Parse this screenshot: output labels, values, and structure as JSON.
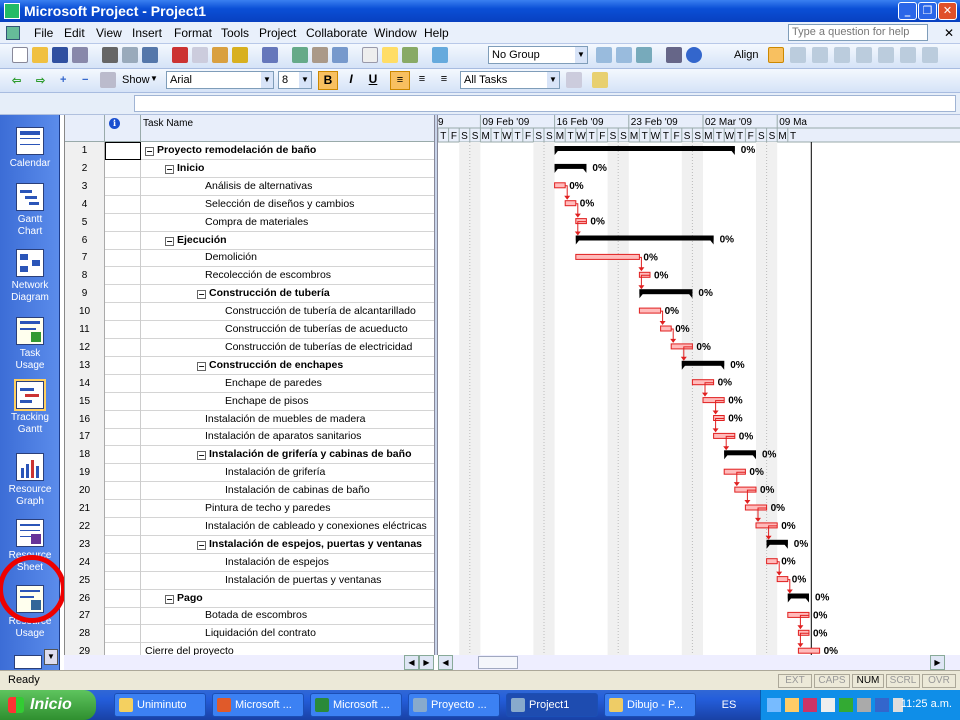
{
  "window": {
    "title": "Microsoft Project - Project1"
  },
  "menubar": {
    "items": [
      "File",
      "Edit",
      "View",
      "Insert",
      "Format",
      "Tools",
      "Project",
      "Collaborate",
      "Window",
      "Help"
    ],
    "help_placeholder": "Type a question for help"
  },
  "toolbar1": {
    "group_value": "No Group",
    "align_label": "Align"
  },
  "toolbar2": {
    "show_label": "Show",
    "font_value": "Arial",
    "size_value": "8",
    "bold": "B",
    "italic": "I",
    "underline": "U",
    "filter_value": "All Tasks"
  },
  "viewbar": {
    "items": [
      {
        "label": "Calendar",
        "icon": "calendar-icon"
      },
      {
        "label": "Gantt Chart",
        "icon": "gantt-icon"
      },
      {
        "label": "Network Diagram",
        "icon": "network-icon"
      },
      {
        "label": "Task Usage",
        "icon": "task-usage-icon"
      },
      {
        "label": "Tracking Gantt",
        "icon": "tracking-icon"
      },
      {
        "label": "Resource Graph",
        "icon": "resource-graph-icon"
      },
      {
        "label": "Resource Sheet",
        "icon": "resource-sheet-icon"
      },
      {
        "label": "Resource Usage",
        "icon": "resource-usage-icon"
      }
    ],
    "highlight_color": "#e00000"
  },
  "grid": {
    "column_indicator_icon": "info-icon",
    "column_task_name": "Task Name",
    "tasks": [
      {
        "id": "1",
        "name": "Proyecto remodelación de baño",
        "level": 0,
        "summary": true
      },
      {
        "id": "2",
        "name": "Inicio",
        "level": 1,
        "summary": true
      },
      {
        "id": "3",
        "name": "Análisis de alternativas",
        "level": 2,
        "summary": false
      },
      {
        "id": "4",
        "name": "Selección de diseños y cambios",
        "level": 2,
        "summary": false
      },
      {
        "id": "5",
        "name": "Compra de materiales",
        "level": 2,
        "summary": false
      },
      {
        "id": "6",
        "name": "Ejecución",
        "level": 1,
        "summary": true
      },
      {
        "id": "7",
        "name": "Demolición",
        "level": 2,
        "summary": false
      },
      {
        "id": "8",
        "name": "Recolección de escombros",
        "level": 2,
        "summary": false
      },
      {
        "id": "9",
        "name": "Construcción de tubería",
        "level": 2,
        "summary": true
      },
      {
        "id": "10",
        "name": "Construcción de tubería de alcantarillado",
        "level": 3,
        "summary": false
      },
      {
        "id": "11",
        "name": "Construcción de tuberías de acueducto",
        "level": 3,
        "summary": false
      },
      {
        "id": "12",
        "name": "Construcción de tuberías de electricidad",
        "level": 3,
        "summary": false
      },
      {
        "id": "13",
        "name": "Construcción de enchapes",
        "level": 2,
        "summary": true
      },
      {
        "id": "14",
        "name": "Enchape de paredes",
        "level": 3,
        "summary": false
      },
      {
        "id": "15",
        "name": "Enchape de pisos",
        "level": 3,
        "summary": false
      },
      {
        "id": "16",
        "name": "Instalación de muebles de madera",
        "level": 2,
        "summary": false
      },
      {
        "id": "17",
        "name": "Instalación de aparatos sanitarios",
        "level": 2,
        "summary": false
      },
      {
        "id": "18",
        "name": "Instalación de grifería y cabinas de baño",
        "level": 2,
        "summary": true
      },
      {
        "id": "19",
        "name": "Instalación de grifería",
        "level": 3,
        "summary": false
      },
      {
        "id": "20",
        "name": "Instalación de cabinas de baño",
        "level": 3,
        "summary": false
      },
      {
        "id": "21",
        "name": "Pintura de techo y paredes",
        "level": 2,
        "summary": false
      },
      {
        "id": "22",
        "name": "Instalación de cableado y conexiones eléctricas",
        "level": 2,
        "summary": false
      },
      {
        "id": "23",
        "name": "Instalación de espejos, puertas y ventanas",
        "level": 2,
        "summary": true
      },
      {
        "id": "24",
        "name": "Instalación de espejos",
        "level": 3,
        "summary": false
      },
      {
        "id": "25",
        "name": "Instalación de puertas y ventanas",
        "level": 3,
        "summary": false
      },
      {
        "id": "26",
        "name": "Pago",
        "level": 1,
        "summary": true
      },
      {
        "id": "27",
        "name": "Botada de escombros",
        "level": 2,
        "summary": false
      },
      {
        "id": "28",
        "name": "Liquidación del contrato",
        "level": 2,
        "summary": false
      },
      {
        "id": "29",
        "name": "Cierre del proyecto",
        "level": 0,
        "summary": false
      }
    ]
  },
  "gantt": {
    "weeks": [
      "9",
      "09 Feb '09",
      "16 Feb '09",
      "23 Feb '09",
      "02 Mar '09",
      "09 Ma"
    ],
    "days": [
      "T",
      "F",
      "S",
      "S",
      "M",
      "T",
      "W",
      "T",
      "F",
      "S",
      "S",
      "M",
      "T",
      "W",
      "T",
      "F",
      "S",
      "S",
      "M",
      "T",
      "W",
      "T",
      "F",
      "S",
      "S",
      "M",
      "T",
      "W",
      "T",
      "F",
      "S",
      "S",
      "M",
      "T"
    ],
    "first_day": "2009-02-05",
    "bars": [
      {
        "row": 1,
        "start": "2009-02-16",
        "end": "2009-03-04",
        "type": "summary",
        "pct": "0%"
      },
      {
        "row": 2,
        "start": "2009-02-16",
        "end": "2009-02-18",
        "type": "summary",
        "pct": "0%"
      },
      {
        "row": 3,
        "start": "2009-02-16",
        "end": "2009-02-16",
        "type": "task",
        "pct": "0%"
      },
      {
        "row": 4,
        "start": "2009-02-17",
        "end": "2009-02-17",
        "type": "task",
        "pct": "0%"
      },
      {
        "row": 5,
        "start": "2009-02-18",
        "end": "2009-02-18",
        "type": "task",
        "pct": "0%"
      },
      {
        "row": 6,
        "start": "2009-02-18",
        "end": "2009-03-02",
        "type": "summary",
        "pct": "0%"
      },
      {
        "row": 7,
        "start": "2009-02-18",
        "end": "2009-02-23",
        "type": "task",
        "pct": "0%"
      },
      {
        "row": 8,
        "start": "2009-02-24",
        "end": "2009-02-24",
        "type": "task",
        "pct": "0%"
      },
      {
        "row": 9,
        "start": "2009-02-24",
        "end": "2009-02-28",
        "type": "summary",
        "pct": "0%"
      },
      {
        "row": 10,
        "start": "2009-02-24",
        "end": "2009-02-25",
        "type": "task",
        "pct": "0%"
      },
      {
        "row": 11,
        "start": "2009-02-26",
        "end": "2009-02-26",
        "type": "task",
        "pct": "0%"
      },
      {
        "row": 12,
        "start": "2009-02-27",
        "end": "2009-02-28",
        "type": "task",
        "pct": "0%"
      },
      {
        "row": 13,
        "start": "2009-02-28",
        "end": "2009-03-03",
        "type": "summary",
        "pct": "0%"
      },
      {
        "row": 14,
        "start": "2009-03-01",
        "end": "2009-03-02",
        "type": "task",
        "pct": "0%"
      },
      {
        "row": 15,
        "start": "2009-03-02",
        "end": "2009-03-03",
        "type": "task",
        "pct": "0%"
      },
      {
        "row": 16,
        "start": "2009-03-03",
        "end": "2009-03-03",
        "type": "task",
        "pct": "0%"
      },
      {
        "row": 17,
        "start": "2009-03-03",
        "end": "2009-03-04",
        "type": "task",
        "pct": "0%"
      },
      {
        "row": 18,
        "start": "2009-03-04",
        "end": "2009-03-06",
        "type": "summary",
        "pct": "0%"
      },
      {
        "row": 19,
        "start": "2009-03-04",
        "end": "2009-03-05",
        "type": "task",
        "pct": "0%"
      },
      {
        "row": 20,
        "start": "2009-03-05",
        "end": "2009-03-06",
        "type": "task",
        "pct": "0%"
      },
      {
        "row": 21,
        "start": "2009-03-06",
        "end": "2009-03-07",
        "type": "task",
        "pct": "0%"
      },
      {
        "row": 22,
        "start": "2009-03-07",
        "end": "2009-03-08",
        "type": "task",
        "pct": "0%"
      },
      {
        "row": 23,
        "start": "2009-03-08",
        "end": "2009-03-09",
        "type": "summary",
        "pct": "0%"
      },
      {
        "row": 24,
        "start": "2009-03-08",
        "end": "2009-03-08",
        "type": "task",
        "pct": "0%"
      },
      {
        "row": 25,
        "start": "2009-03-09",
        "end": "2009-03-09",
        "type": "task",
        "pct": "0%"
      },
      {
        "row": 26,
        "start": "2009-03-10",
        "end": "2009-03-11",
        "type": "summary",
        "pct": "0%"
      },
      {
        "row": 27,
        "start": "2009-03-10",
        "end": "2009-03-11",
        "type": "task",
        "pct": "0%"
      },
      {
        "row": 28,
        "start": "2009-03-11",
        "end": "2009-03-11",
        "type": "task",
        "pct": "0%"
      },
      {
        "row": 29,
        "start": "2009-03-11",
        "end": "2009-03-12",
        "type": "task",
        "pct": "0%"
      }
    ],
    "summary_color": "#000000",
    "task_color": "#e02020",
    "today_line": "2009-03-12"
  },
  "status": {
    "ready": "Ready",
    "indicators": [
      "EXT",
      "CAPS",
      "NUM",
      "SCRL",
      "OVR"
    ],
    "active": "NUM"
  },
  "taskbar": {
    "start_label": "Inicio",
    "tasks": [
      "Uniminuto",
      "Microsoft ...",
      "Microsoft ...",
      "Proyecto ...",
      "Project1",
      "Dibujo - P..."
    ],
    "active_task": "Project1",
    "language": "ES",
    "clock": "11:25 a.m."
  }
}
